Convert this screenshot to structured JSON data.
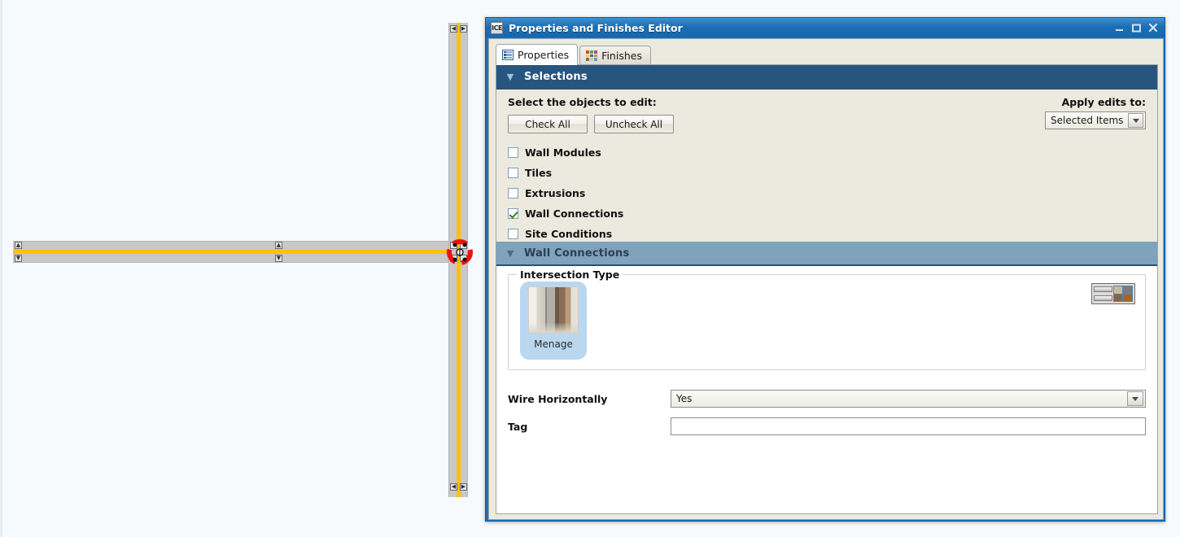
{
  "canvas": {
    "name": "cad-drawing-area",
    "walls": {
      "horizontal_label": "horizontal-wall",
      "vertical_label": "vertical-wall",
      "intersection_label": "wall-intersection-marker"
    }
  },
  "dialog": {
    "title": "Properties and Finishes Editor",
    "icon_text": "ICE",
    "window_buttons": {
      "minimize": "minimize",
      "maximize": "maximize",
      "close": "close"
    },
    "tabs": [
      {
        "label": "Properties",
        "icon": "list-icon",
        "active": true
      },
      {
        "label": "Finishes",
        "icon": "color-swatch-icon",
        "active": false
      }
    ],
    "selections": {
      "header": "Selections",
      "chevron": "chevron-down-icon",
      "prompt": "Select the objects to edit:",
      "buttons": [
        {
          "label": "Check All"
        },
        {
          "label": "Uncheck All"
        }
      ],
      "apply_label": "Apply edits to:",
      "apply_value": "Selected Items",
      "checkboxes": [
        {
          "label": "Wall Modules",
          "checked": false
        },
        {
          "label": "Tiles",
          "checked": false
        },
        {
          "label": "Extrusions",
          "checked": false
        },
        {
          "label": "Wall Connections",
          "checked": true
        },
        {
          "label": "Site Conditions",
          "checked": false
        }
      ]
    },
    "wall_connections": {
      "header": "Wall Connections",
      "chevron": "chevron-down-icon",
      "intersection_legend": "Intersection Type",
      "thumbnails": [
        {
          "label": "Menage",
          "selected": true
        }
      ],
      "view_toggle": "list-grid-view-toggle-icon",
      "fields": [
        {
          "label": "Wire Horizontally",
          "type": "combo",
          "value": "Yes"
        },
        {
          "label": "Tag",
          "type": "text",
          "value": ""
        }
      ]
    }
  },
  "colors": {
    "titlebar_blue": "#1d6fb5",
    "section_primary": "#28557f",
    "section_secondary": "#7fa2bd",
    "panel_bg": "#eceadf",
    "wall_fill": "#c8c8c8",
    "wall_centerline": "#ffc107",
    "marker_red": "#ee1111",
    "selected_thumb": "#b9d8f0",
    "check_green": "#3a7d22"
  }
}
